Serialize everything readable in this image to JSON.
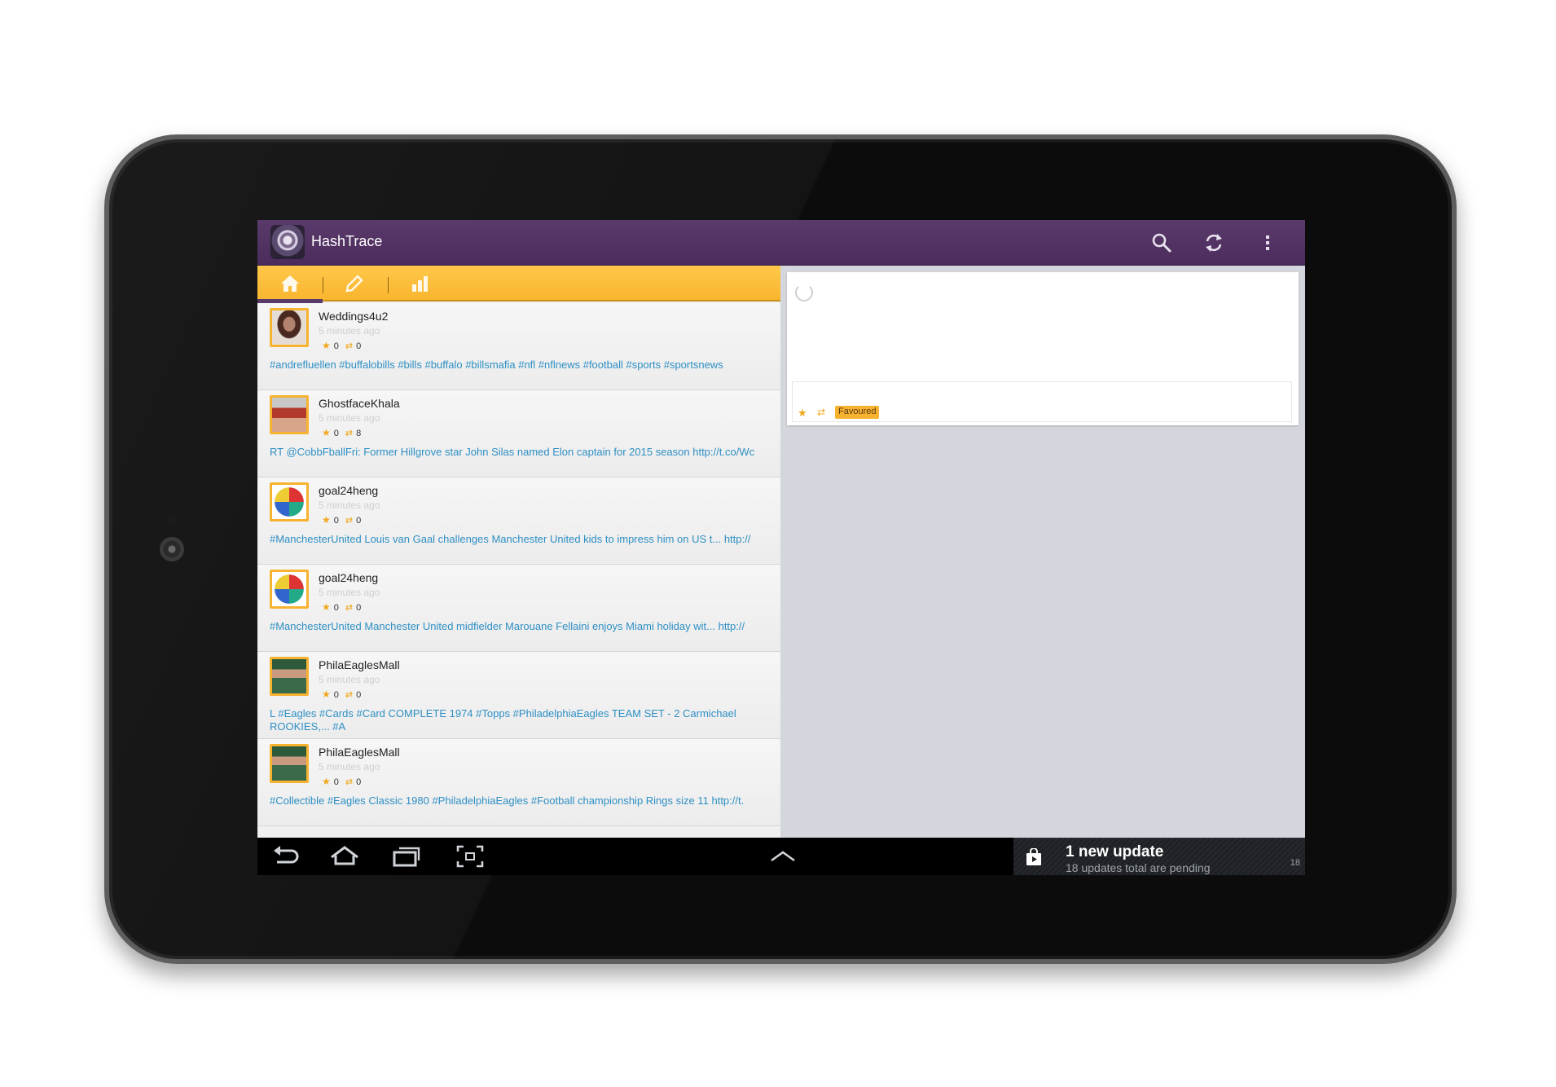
{
  "app": {
    "title": "HashTrace",
    "icon": "hashtrace-app-icon"
  },
  "actionbar": {
    "search_icon": "search-icon",
    "refresh_icon": "refresh-icon",
    "overflow_icon": "overflow-menu-icon"
  },
  "tabs": [
    {
      "name": "home",
      "icon": "home-icon",
      "active": true
    },
    {
      "name": "compose",
      "icon": "pencil-icon",
      "active": false
    },
    {
      "name": "stats",
      "icon": "bar-chart-icon",
      "active": false
    }
  ],
  "tweets": [
    {
      "user": "Weddings4u2",
      "time": "5 minutes ago",
      "favorites": "0",
      "retweets": "0",
      "text": "#andrefluellen #buffalobills #bills #buffalo #billsmafia #nfl #nflnews #football #sports #sportsnews"
    },
    {
      "user": "GhostfaceKhala",
      "time": "5 minutes ago",
      "favorites": "0",
      "retweets": "8",
      "text": "RT @CobbFballFri: Former Hillgrove star John Silas named Elon captain for 2015 season http://t.co/Wc"
    },
    {
      "user": "goal24heng",
      "time": "5 minutes ago",
      "favorites": "0",
      "retweets": "0",
      "text": "#ManchesterUnited Louis van Gaal challenges Manchester United kids to impress him on US t... http://"
    },
    {
      "user": "goal24heng",
      "time": "5 minutes ago",
      "favorites": "0",
      "retweets": "0",
      "text": "#ManchesterUnited Manchester United midfielder Marouane Fellaini enjoys Miami holiday wit... http://"
    },
    {
      "user": "PhilaEaglesMall",
      "time": "5 minutes ago",
      "favorites": "0",
      "retweets": "0",
      "text": "L #Eagles #Cards #Card COMPLETE 1974 #Topps #PhiladelphiaEagles TEAM SET - 2 Carmichael ROOKIES,... #A"
    },
    {
      "user": "PhilaEaglesMall",
      "time": "5 minutes ago",
      "favorites": "0",
      "retweets": "0",
      "text": "#Collectible #Eagles Classic 1980 #PhiladelphiaEagles #Football championship Rings size 11 http://t."
    }
  ],
  "detail": {
    "favoured_label": "Favoured"
  },
  "notification": {
    "title": "1 new update",
    "subtitle": "18 updates total are pending",
    "count": "18",
    "icon": "play-store-bag-icon"
  },
  "navbar": {
    "back_icon": "back-icon",
    "home_icon": "home-nav-icon",
    "recents_icon": "recent-apps-icon",
    "screenshot_icon": "screenshot-icon",
    "expand_icon": "chevron-up-icon"
  },
  "colors": {
    "actionbar": "#4b2c5c",
    "tabbar": "#f9b52e",
    "link": "#2e8fc4",
    "accent": "#f7b230"
  }
}
